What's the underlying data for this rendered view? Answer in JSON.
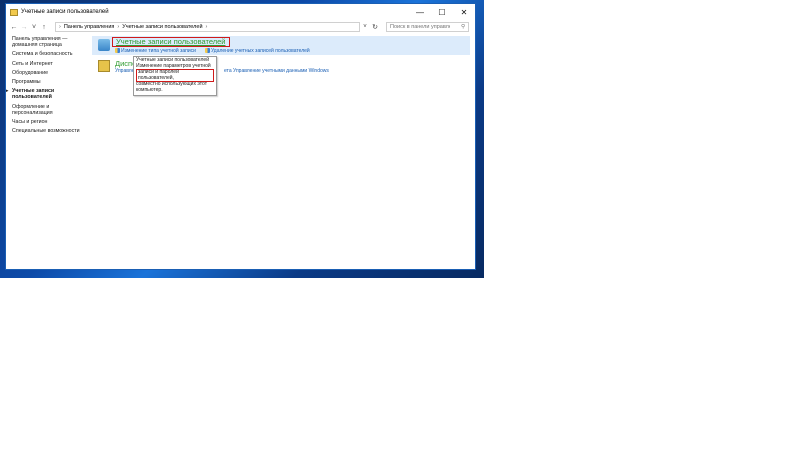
{
  "window": {
    "title": "Учетные записи пользователей",
    "minimize_icon": "minimize-icon",
    "maximize_icon": "maximize-icon",
    "close_icon": "close-icon"
  },
  "navigation": {
    "back": "←",
    "forward": "→",
    "recent": "˅",
    "up": "↑",
    "breadcrumb": [
      "Панель управления",
      "Учетные записи пользователей"
    ],
    "separator": "›",
    "refresh": "↻",
    "search_placeholder": "Поиск в панели управления"
  },
  "sidebar": {
    "items": [
      {
        "label": "Панель управления — домашняя страница"
      },
      {
        "label": "Система и безопасность"
      },
      {
        "label": "Сеть и Интернет"
      },
      {
        "label": "Оборудование"
      },
      {
        "label": "Программы"
      },
      {
        "label": "Учетные записи пользователей",
        "active": true
      },
      {
        "label": "Оформление и персонализация"
      },
      {
        "label": "Часы и регион"
      },
      {
        "label": "Специальные возможности"
      }
    ]
  },
  "categories": [
    {
      "title": "Учетные записи пользователей",
      "links": [
        "Изменение типа учетной записи",
        "Удаление учетных записей пользователей"
      ]
    },
    {
      "title": "Диспе",
      "links": [
        "Управле",
        "ета",
        "Управление учетными данными Windows"
      ]
    }
  ],
  "tooltip": {
    "lines": [
      "Учетные записи пользователей",
      "Изменение параметров учетной",
      "записи и паролей пользователей,",
      "совместно использующих этот",
      "компьютер."
    ]
  },
  "colors": {
    "accent": "#1a5fb4",
    "category_title": "#2f9b2f",
    "highlight_box": "#d11a1a",
    "hover_bg": "#dcebfb"
  }
}
